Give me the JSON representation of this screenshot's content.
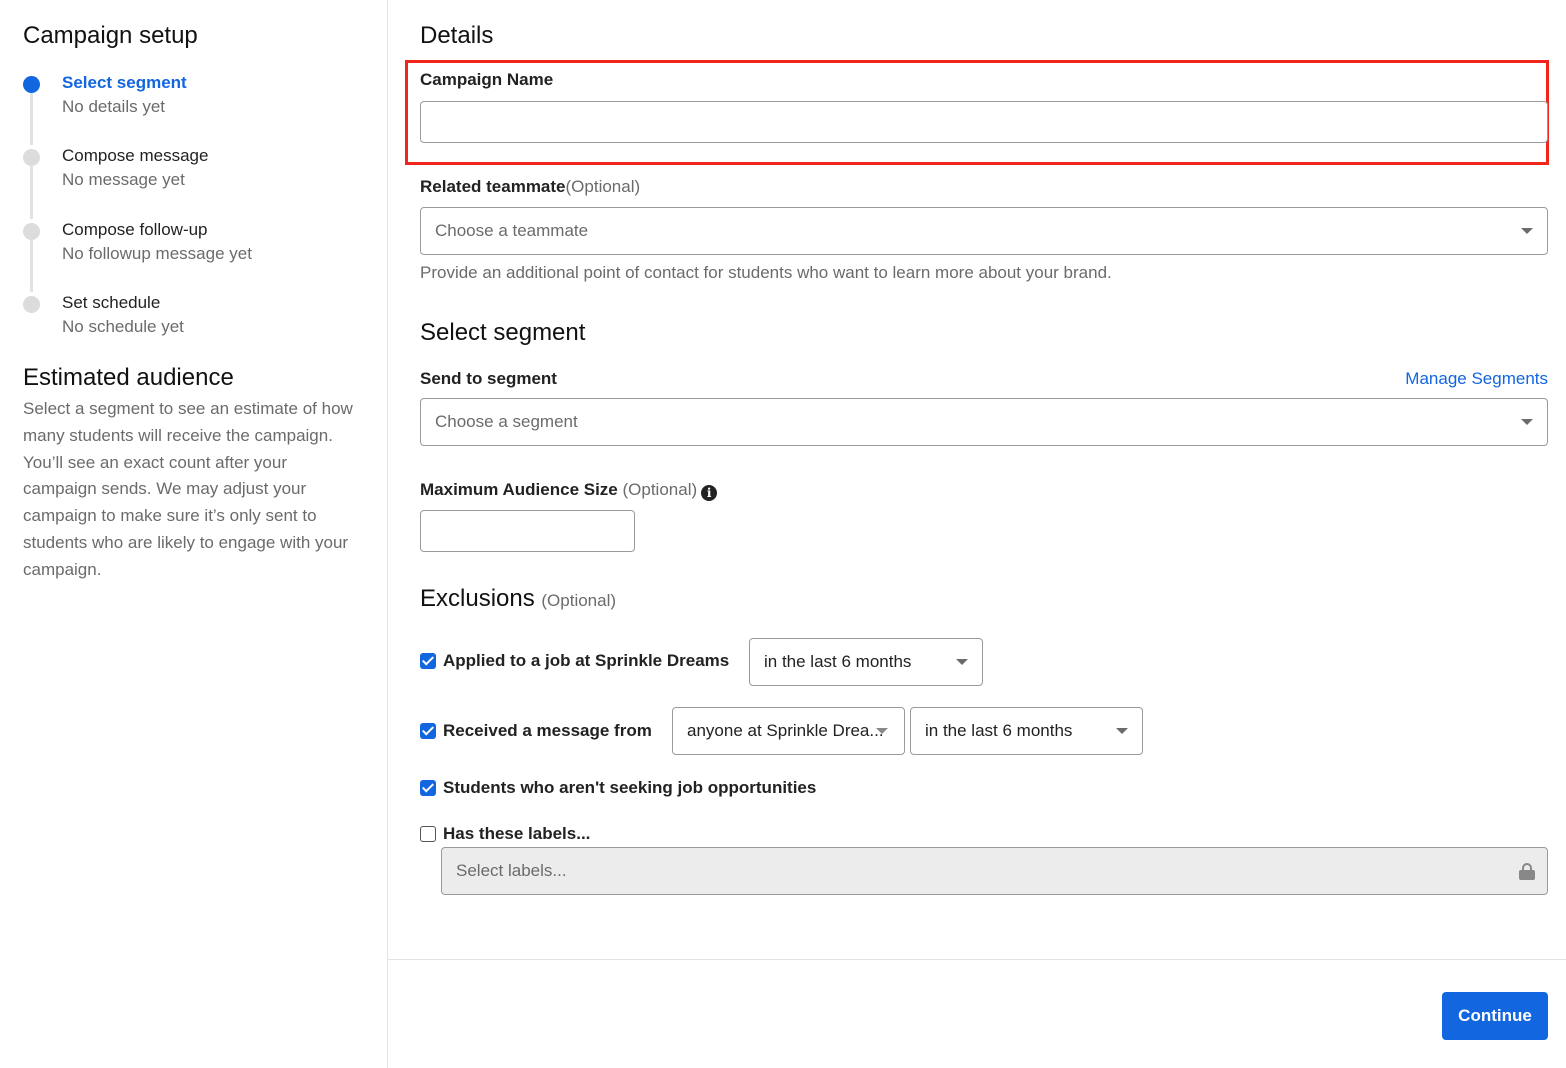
{
  "sidebar": {
    "title": "Campaign setup",
    "steps": [
      {
        "label": "Select segment",
        "sub": "No details yet"
      },
      {
        "label": "Compose message",
        "sub": "No message yet"
      },
      {
        "label": "Compose follow-up",
        "sub": "No followup message yet"
      },
      {
        "label": "Set schedule",
        "sub": "No schedule yet"
      }
    ],
    "audience": {
      "title": "Estimated audience",
      "text": "Select a segment to see an estimate of how many students will receive the campaign. You’ll see an exact count after your campaign sends. We may adjust your campaign to make sure it’s only sent to students who are likely to engage with your campaign."
    }
  },
  "details": {
    "title": "Details",
    "campaign_name": {
      "label": "Campaign Name",
      "value": ""
    },
    "teammate": {
      "label": "Related teammate",
      "optional": "(Optional)",
      "placeholder": "Choose a teammate",
      "helper": "Provide an additional point of contact for students who want to learn more about your brand."
    }
  },
  "segment": {
    "title": "Select segment",
    "send_label": "Send to segment",
    "manage_link": "Manage Segments",
    "placeholder": "Choose a segment",
    "max_label": "Maximum Audience Size",
    "max_optional": "(Optional)",
    "max_value": "",
    "info_icon": "i"
  },
  "exclusions": {
    "title": "Exclusions",
    "optional": "(Optional)",
    "items": {
      "applied": {
        "checked": true,
        "label": "Applied to a job at Sprinkle Dreams",
        "period": "in the last 6 months"
      },
      "received": {
        "checked": true,
        "label": "Received a message from",
        "sender": "anyone at Sprinkle Drea...",
        "period": "in the last 6 months"
      },
      "not_seeking": {
        "checked": true,
        "label": "Students who aren't seeking job opportunities"
      },
      "labels": {
        "checked": false,
        "label": "Has these labels...",
        "placeholder": "Select labels..."
      }
    }
  },
  "footer": {
    "continue_label": "Continue"
  },
  "colors": {
    "accent": "#1266e0",
    "highlight": "#f0261c"
  }
}
